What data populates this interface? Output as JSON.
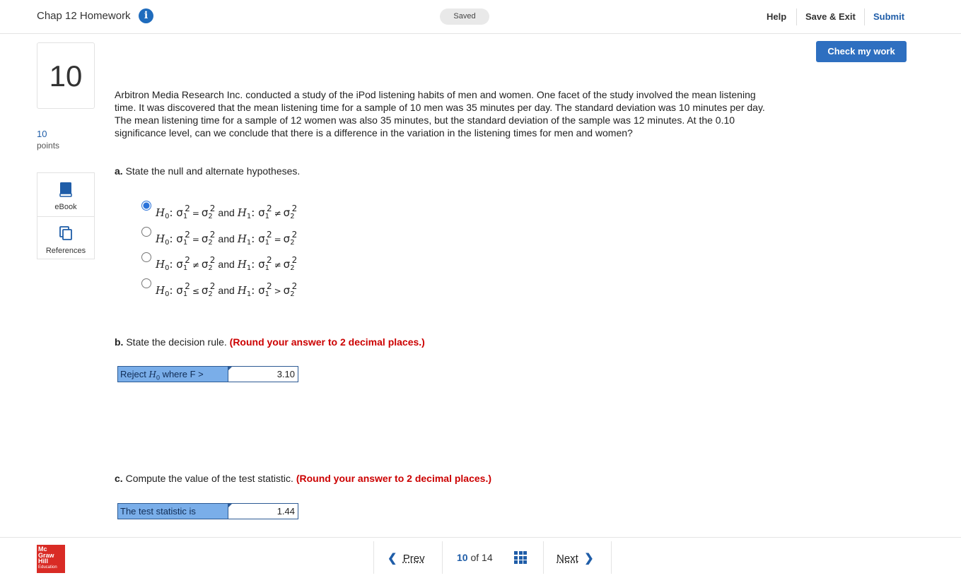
{
  "header": {
    "assignment_title": "Chap 12 Homework",
    "info_icon": "info-icon",
    "saved_status": "Saved",
    "help_label": "Help",
    "save_exit_label": "Save & Exit",
    "submit_label": "Submit"
  },
  "check_my_work_label": "Check my work",
  "question": {
    "number": "10",
    "points_value": "10",
    "points_label": "points",
    "text": "Arbitron Media Research Inc. conducted a study of the iPod listening habits of men and women. One facet of the study involved the mean listening time. It was discovered that the mean listening time for a sample of 10 men was 35 minutes per day. The standard deviation was 10 minutes per day. The mean listening time for a sample of 12 women was also 35 minutes, but the standard deviation of the sample was 12 minutes. At the 0.10 significance level, can we conclude that there is a difference in the variation in the listening times for men and women?"
  },
  "sidebar": {
    "ebook_label": "eBook",
    "references_label": "References"
  },
  "part_a": {
    "label": "a.",
    "prompt": "State the null and alternate hypotheses.",
    "selected_index": 0,
    "options": [
      {
        "h0_op": "=",
        "h1_op": "≠"
      },
      {
        "h0_op": "=",
        "h1_op": "="
      },
      {
        "h0_op": "≠",
        "h1_op": "≠"
      },
      {
        "h0_op": "≤",
        "h1_op": ">"
      }
    ],
    "and_text": "and"
  },
  "part_b": {
    "label": "b.",
    "prompt": "State the decision rule.",
    "note": "(Round your answer to 2 decimal places.)",
    "row_label_prefix": "Reject ",
    "row_label_h": "H",
    "row_label_sub": "0",
    "row_label_suffix": " where F >",
    "value": "3.10"
  },
  "part_c": {
    "label": "c.",
    "prompt": "Compute the value of the test statistic.",
    "note": "(Round your answer to 2 decimal places.)",
    "row_label": "The test statistic is",
    "value": "1.44"
  },
  "footer": {
    "logo_lines": [
      "Mc",
      "Graw",
      "Hill",
      "Education"
    ],
    "prev_label": "Prev",
    "current_page": "10",
    "of_label": "of",
    "total_pages": "14",
    "next_label": "Next"
  },
  "colors": {
    "accent": "#1f5da8",
    "button": "#2e6fc0",
    "answer_label_bg": "#7aaee9",
    "note_red": "#cc0000",
    "logo_red": "#d92b25"
  }
}
